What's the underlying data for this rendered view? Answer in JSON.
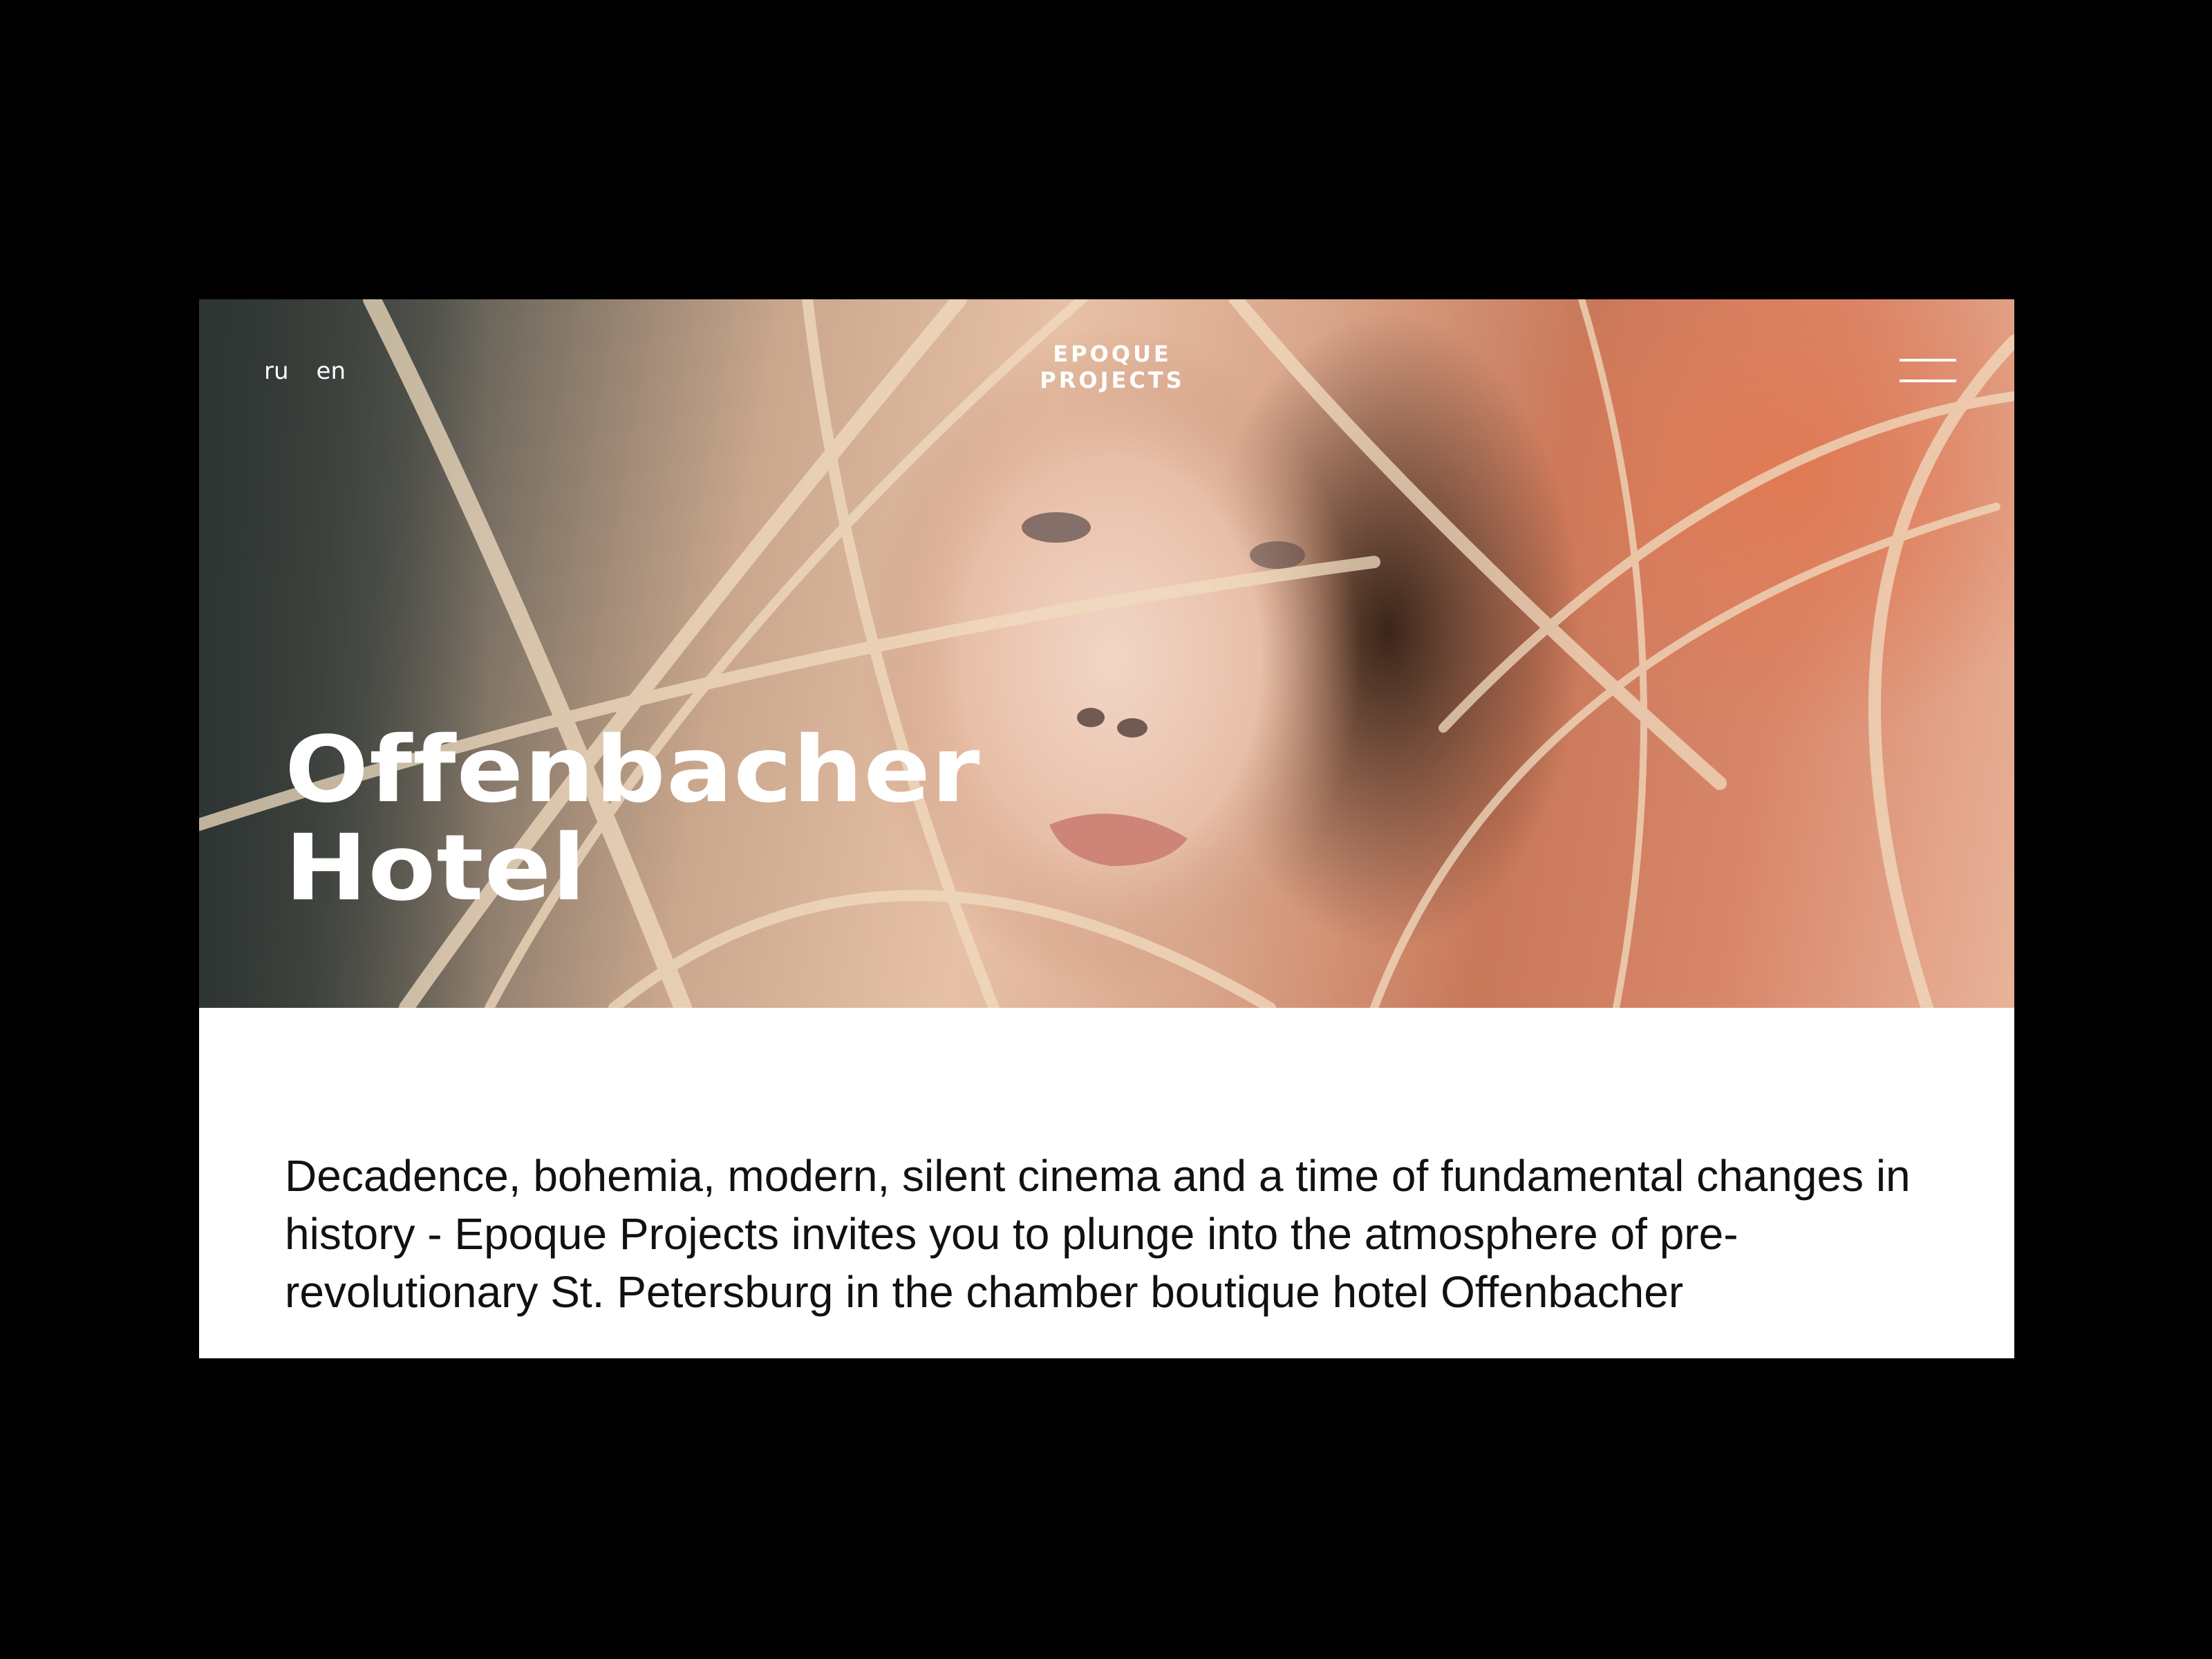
{
  "header": {
    "languages": [
      "ru",
      "en"
    ],
    "logo_line1": "EPOQUE",
    "logo_line2": "PROJECTS"
  },
  "hero": {
    "title_line1": "Offenbacher",
    "title_line2": "Hotel"
  },
  "intro": {
    "text": "Decadence, bohemia, modern, silent cinema and a time of fundamental changes in history - Epoque Projects invites you to plunge into the atmosphere of pre-revolutionary St. Petersburg in the chamber boutique hotel Offenbacher"
  },
  "icons": {
    "menu": "hamburger-icon"
  },
  "colors": {
    "background": "#000000",
    "text_dark": "#111111",
    "text_light": "#ffffff"
  }
}
